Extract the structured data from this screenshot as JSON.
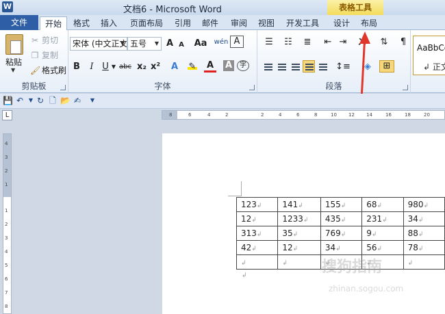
{
  "app": {
    "title": "文档6 - Microsoft Word",
    "icon_letter": "W",
    "context_group": "表格工具"
  },
  "tabs": [
    "文件",
    "开始",
    "格式",
    "插入",
    "页面布局",
    "引用",
    "邮件",
    "审阅",
    "视图",
    "开发工具",
    "设计",
    "布局"
  ],
  "ribbon": {
    "clipboard": {
      "label": "剪贴板",
      "paste": "粘贴",
      "cut": "剪切",
      "copy": "复制",
      "format_painter": "格式刷"
    },
    "font": {
      "label": "字体",
      "font_name": "宋体 (中文正文)",
      "font_size": "五号",
      "bold": "B",
      "italic": "I",
      "underline": "U",
      "strike": "abc",
      "subscript": "x₂",
      "superscript": "x²",
      "grow": "A",
      "shrink": "A",
      "change_case": "Aa",
      "phonetic": "wén",
      "border_char": "A",
      "clear": "A",
      "char_shade": "A",
      "enclose": "字"
    },
    "paragraph": {
      "label": "段落"
    },
    "styles": {
      "sample": "AaBbCcDd",
      "name": "↲ 正文"
    }
  },
  "qat": [
    "save-icon",
    "undo-icon",
    "redo-icon",
    "new-icon",
    "open-icon",
    "edit-icon",
    "customize-icon"
  ],
  "ruler": {
    "corner": "L",
    "h_ticks": [
      "8",
      "6",
      "4",
      "2",
      "2",
      "4",
      "6",
      "8",
      "10",
      "12",
      "14",
      "16",
      "18",
      "20"
    ],
    "v_ticks": [
      "4",
      "3",
      "2",
      "1",
      "1",
      "2",
      "3",
      "4",
      "5",
      "6",
      "7",
      "8"
    ]
  },
  "table": {
    "rows": [
      [
        "123",
        "141",
        "155",
        "68",
        "980"
      ],
      [
        "12",
        "1233",
        "435",
        "231",
        "34"
      ],
      [
        "313",
        "35",
        "769",
        "9",
        "88"
      ],
      [
        "42",
        "12",
        "34",
        "56",
        "78"
      ],
      [
        "",
        "",
        "",
        "",
        ""
      ]
    ],
    "para_mark": "↲"
  },
  "watermark": {
    "main": "搜狗指南",
    "sub": "zhinan.sogou.com"
  },
  "colors": {
    "accent": "#2d5ea6",
    "context": "#f3dc5c",
    "arrow": "#e0362b",
    "highlight_sel": "#f6d77c"
  }
}
